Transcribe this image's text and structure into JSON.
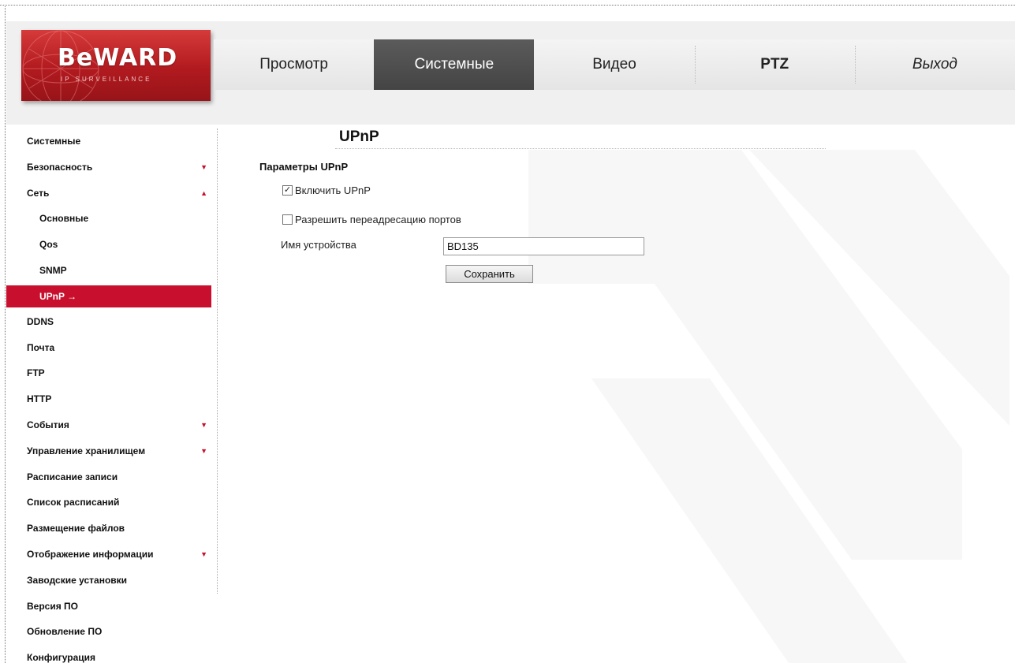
{
  "logo": {
    "text": "BeWARD",
    "subtext": "IP SURVEILLANCE"
  },
  "nav": {
    "tabs": [
      {
        "label": "Просмотр"
      },
      {
        "label": "Системные"
      },
      {
        "label": "Видео"
      },
      {
        "label": "PTZ"
      },
      {
        "label": "Выход"
      }
    ],
    "active": "Системные"
  },
  "sidebar": {
    "items": [
      {
        "label": "Системные"
      },
      {
        "label": "Безопасность",
        "arrow": "▼"
      },
      {
        "label": "Сеть",
        "arrow": "▲"
      },
      {
        "label": "Основные"
      },
      {
        "label": "Qos"
      },
      {
        "label": "SNMP"
      },
      {
        "label": "UPnP →"
      },
      {
        "label": "DDNS"
      },
      {
        "label": "Почта"
      },
      {
        "label": "FTP"
      },
      {
        "label": "HTTP"
      },
      {
        "label": "События",
        "arrow": "▼"
      },
      {
        "label": "Управление хранилищем",
        "arrow": "▼"
      },
      {
        "label": "Расписание записи"
      },
      {
        "label": "Список расписаний"
      },
      {
        "label": "Размещение файлов"
      },
      {
        "label": "Отображение информации",
        "arrow": "▼"
      },
      {
        "label": "Заводские установки"
      },
      {
        "label": "Версия ПО"
      },
      {
        "label": "Обновление ПО"
      },
      {
        "label": "Конфигурация"
      }
    ],
    "active_item": "UPnP"
  },
  "main": {
    "title": "UPnP",
    "section_title": "Параметры UPnP",
    "enable_upnp": {
      "label": "Включить UPnP",
      "checked": true,
      "mark": "✓"
    },
    "port_forwarding": {
      "label": "Разрешить переадресацию портов",
      "checked": false,
      "mark": ""
    },
    "device_name": {
      "label": "Имя устройства",
      "value": "BD135"
    },
    "save_label": "Сохранить"
  },
  "colors": {
    "accent": "#c8102e",
    "active_tab": "#4f4f4f",
    "header_bg": "#f0f0f0"
  }
}
